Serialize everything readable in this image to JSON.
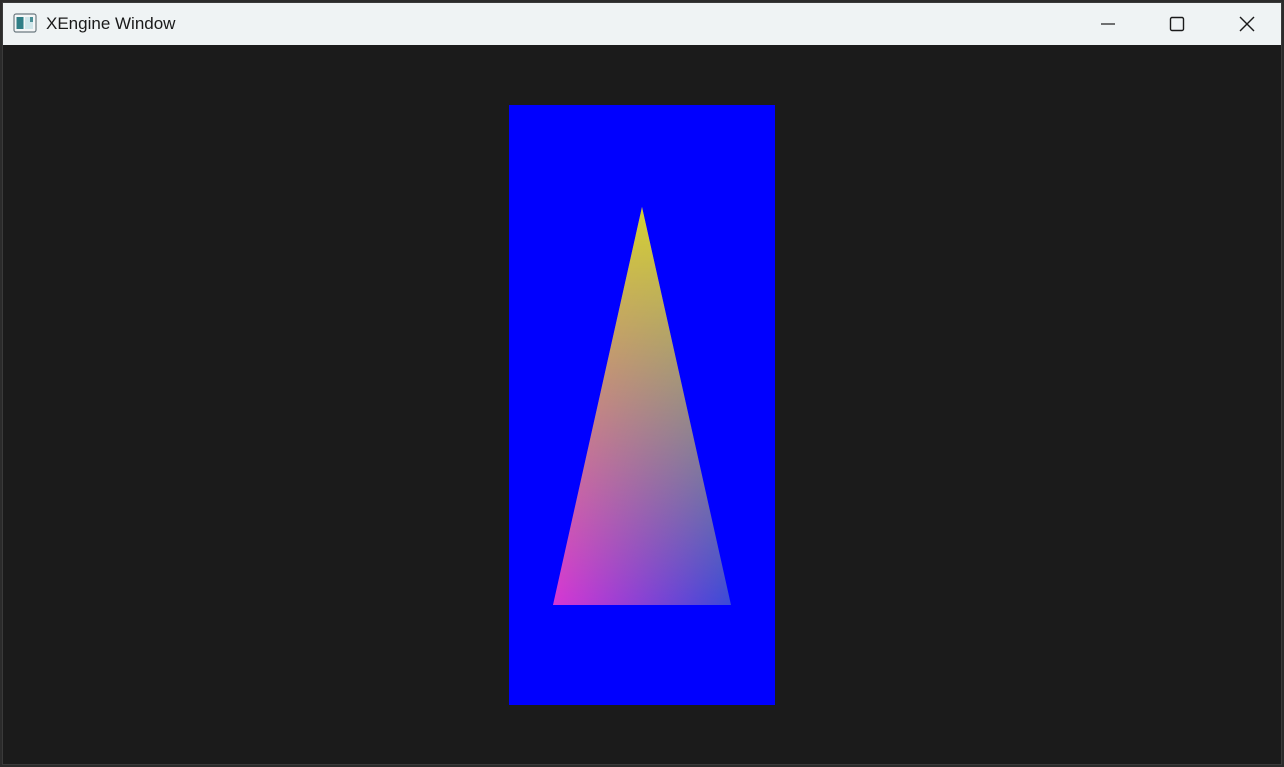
{
  "window": {
    "title": "XEngine Window"
  },
  "controls": {
    "minimize": "minimize-icon",
    "maximize": "maximize-icon",
    "close": "close-icon"
  },
  "scene": {
    "clear_color": "#1b1b1b",
    "viewport_color": "#0000ff",
    "triangle_colors": {
      "top": "#d4d133",
      "bottom_left": "#d636d4",
      "bottom_right": "#3a4ad8"
    }
  }
}
